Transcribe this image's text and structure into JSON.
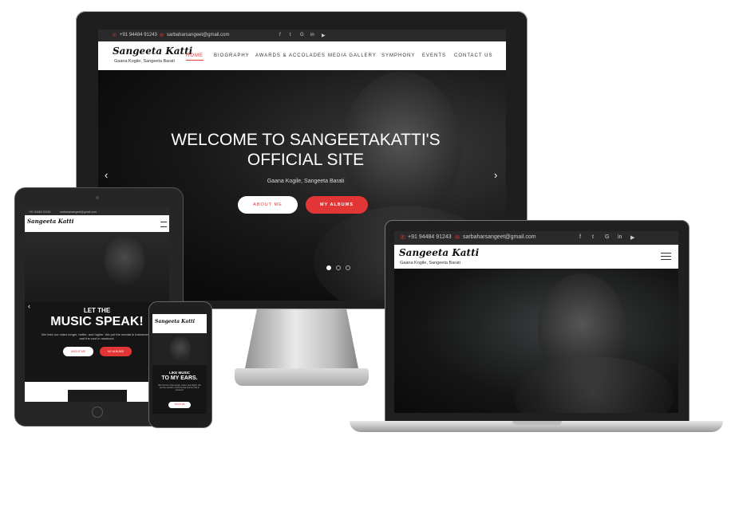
{
  "site": {
    "phone": "+91 94484 91243",
    "email": "sarbaharsangeet@gmail.com",
    "social_icons": [
      "facebook-icon",
      "twitter-icon",
      "google-icon",
      "linkedin-icon",
      "youtube-icon"
    ],
    "social_glyphs": [
      "f",
      "t",
      "G",
      "in",
      "▶"
    ],
    "logo": "Sangeeta Katti",
    "tagline": "Gaana Kogile, Sangeeta Barati"
  },
  "desktop": {
    "nav": [
      "HOME",
      "BIOGRAPHY",
      "AWARDS & ACCOLADES",
      "MEDIA GALLERY",
      "SYMPHONY",
      "EVENTS",
      "CONTACT US"
    ],
    "hero_title_line1": "WELCOME TO SANGEETAKATTI'S",
    "hero_title_line2": "OFFICIAL SITE",
    "hero_sub": "Gaana Kogile, Sangeeta Barati",
    "btn_about": "ABOUT ME",
    "btn_albums": "MY ALBUMS"
  },
  "tablet": {
    "phone": "+91 94484 91243",
    "email": "sarbaharsangeet@gmail.com",
    "hero_line1": "LET THE",
    "hero_line2": "MUSIC SPEAK!",
    "hero_sub": "We hold our notes longer, better, and higher. We put the mental in instrumental and the cool in musicool.",
    "btn_about": "ABOUT ME",
    "btn_albums": "MY ALBUMS"
  },
  "phone": {
    "line1": "LIKE MUSIC",
    "line2": "TO MY EARS.",
    "sub": "We hold our notes longer, better, and higher. We put the mental in instrumental and the cool in musicool.",
    "btn": "ABOUT ME"
  },
  "colors": {
    "accent": "#e23636",
    "dark": "#1e1e1e"
  }
}
